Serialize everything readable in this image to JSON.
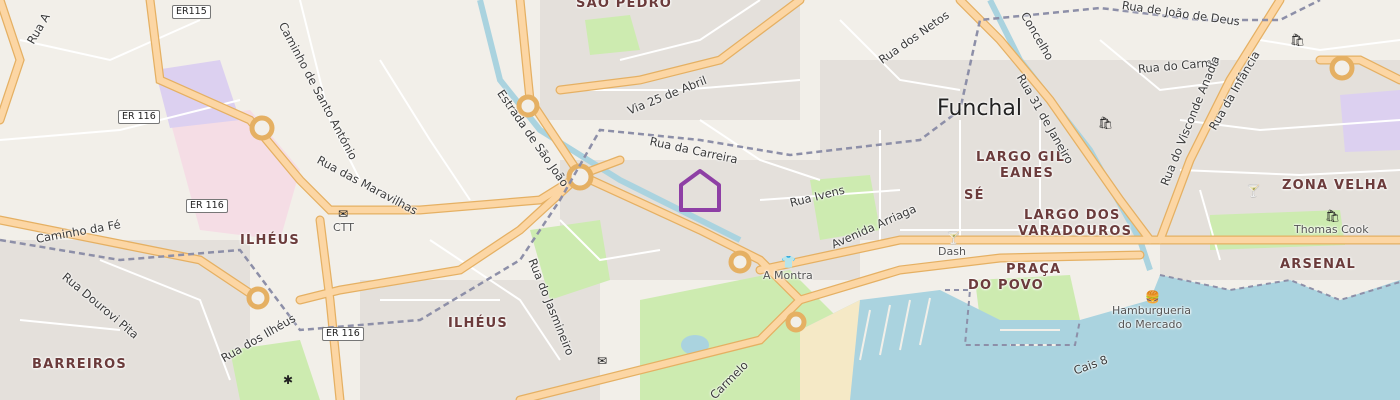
{
  "map": {
    "city": "Funchal",
    "districts": {
      "sao_pedro": "SÃO PEDRO",
      "ilheus_1": "ILHÉUS",
      "ilheus_2": "ILHÉUS",
      "barreiros": "BARREIROS",
      "largo_gil_eanes_1": "LARGO GIL",
      "largo_gil_eanes_2": "EANES",
      "se": "SÉ",
      "largo_varadouros_1": "LARGO DOS",
      "largo_varadouros_2": "VARADOUROS",
      "zona_velha": "ZONA VELHA",
      "praca_povo_1": "PRAÇA",
      "praca_povo_2": "DO POVO",
      "arsenal": "ARSENAL"
    },
    "streets": {
      "rua_a": "Rua A",
      "caminho_santo_antonio": "Caminho de Santo António",
      "rua_maravilhas": "Rua das Maravilhas",
      "caminho_fe": "Caminho da Fé",
      "rua_dourovi_pita": "Rua Dourovi Pita",
      "estrada_sao_joao": "Estrada de São João",
      "via_25_abril": "Via 25 de Abril",
      "rua_carreira": "Rua da Carreira",
      "rua_netos": "Rua dos Netos",
      "concelho": "Concelho",
      "rua_joao_deus": "Rua de João de Deus",
      "rua_carmo": "Rua do Carmo",
      "rua_31_janeiro": "Rua 31 de Janeiro",
      "rua_visconde_anadia": "Rua do Visconde Anadia",
      "rua_infancia": "Rua da Infância",
      "rua_ivens": "Rua Ivens",
      "avenida_arriaga": "Avenida Arriaga",
      "rua_jasmineiro": "Rua do Jasmineiro",
      "rua_ilheus": "Rua dos Ilhéus",
      "carmelo": "Carmelo",
      "cais_8": "Cais 8"
    },
    "pois": {
      "ctt": "CTT",
      "a_montra": "A Montra",
      "dash": "Dash",
      "thomas_cook": "Thomas Cook",
      "hamburgueria_1": "Hamburgueria",
      "hamburgueria_2": "do Mercado"
    },
    "road_refs": {
      "er115": "ER115",
      "er116_a": "ER 116",
      "er116_b": "ER 116",
      "er116_c": "ER 116"
    },
    "icons": {
      "ctt": "envelope-icon",
      "a_montra": "clothing-icon",
      "dash": "bar-icon",
      "zona_velha": "bar-icon",
      "thomas_cook": "shop-icon",
      "hamburgueria": "fast-food-icon",
      "marker": "house-marker-icon"
    },
    "colors": {
      "land": "#f2efe9",
      "residential": "#e0dfdf",
      "park": "#cdebb0",
      "water": "#aad3df",
      "major_road": "#fcd6a4",
      "major_road_casing": "#e5b063",
      "admin_boundary": "#8d8fa8",
      "marker": "#8e3fa5"
    }
  }
}
